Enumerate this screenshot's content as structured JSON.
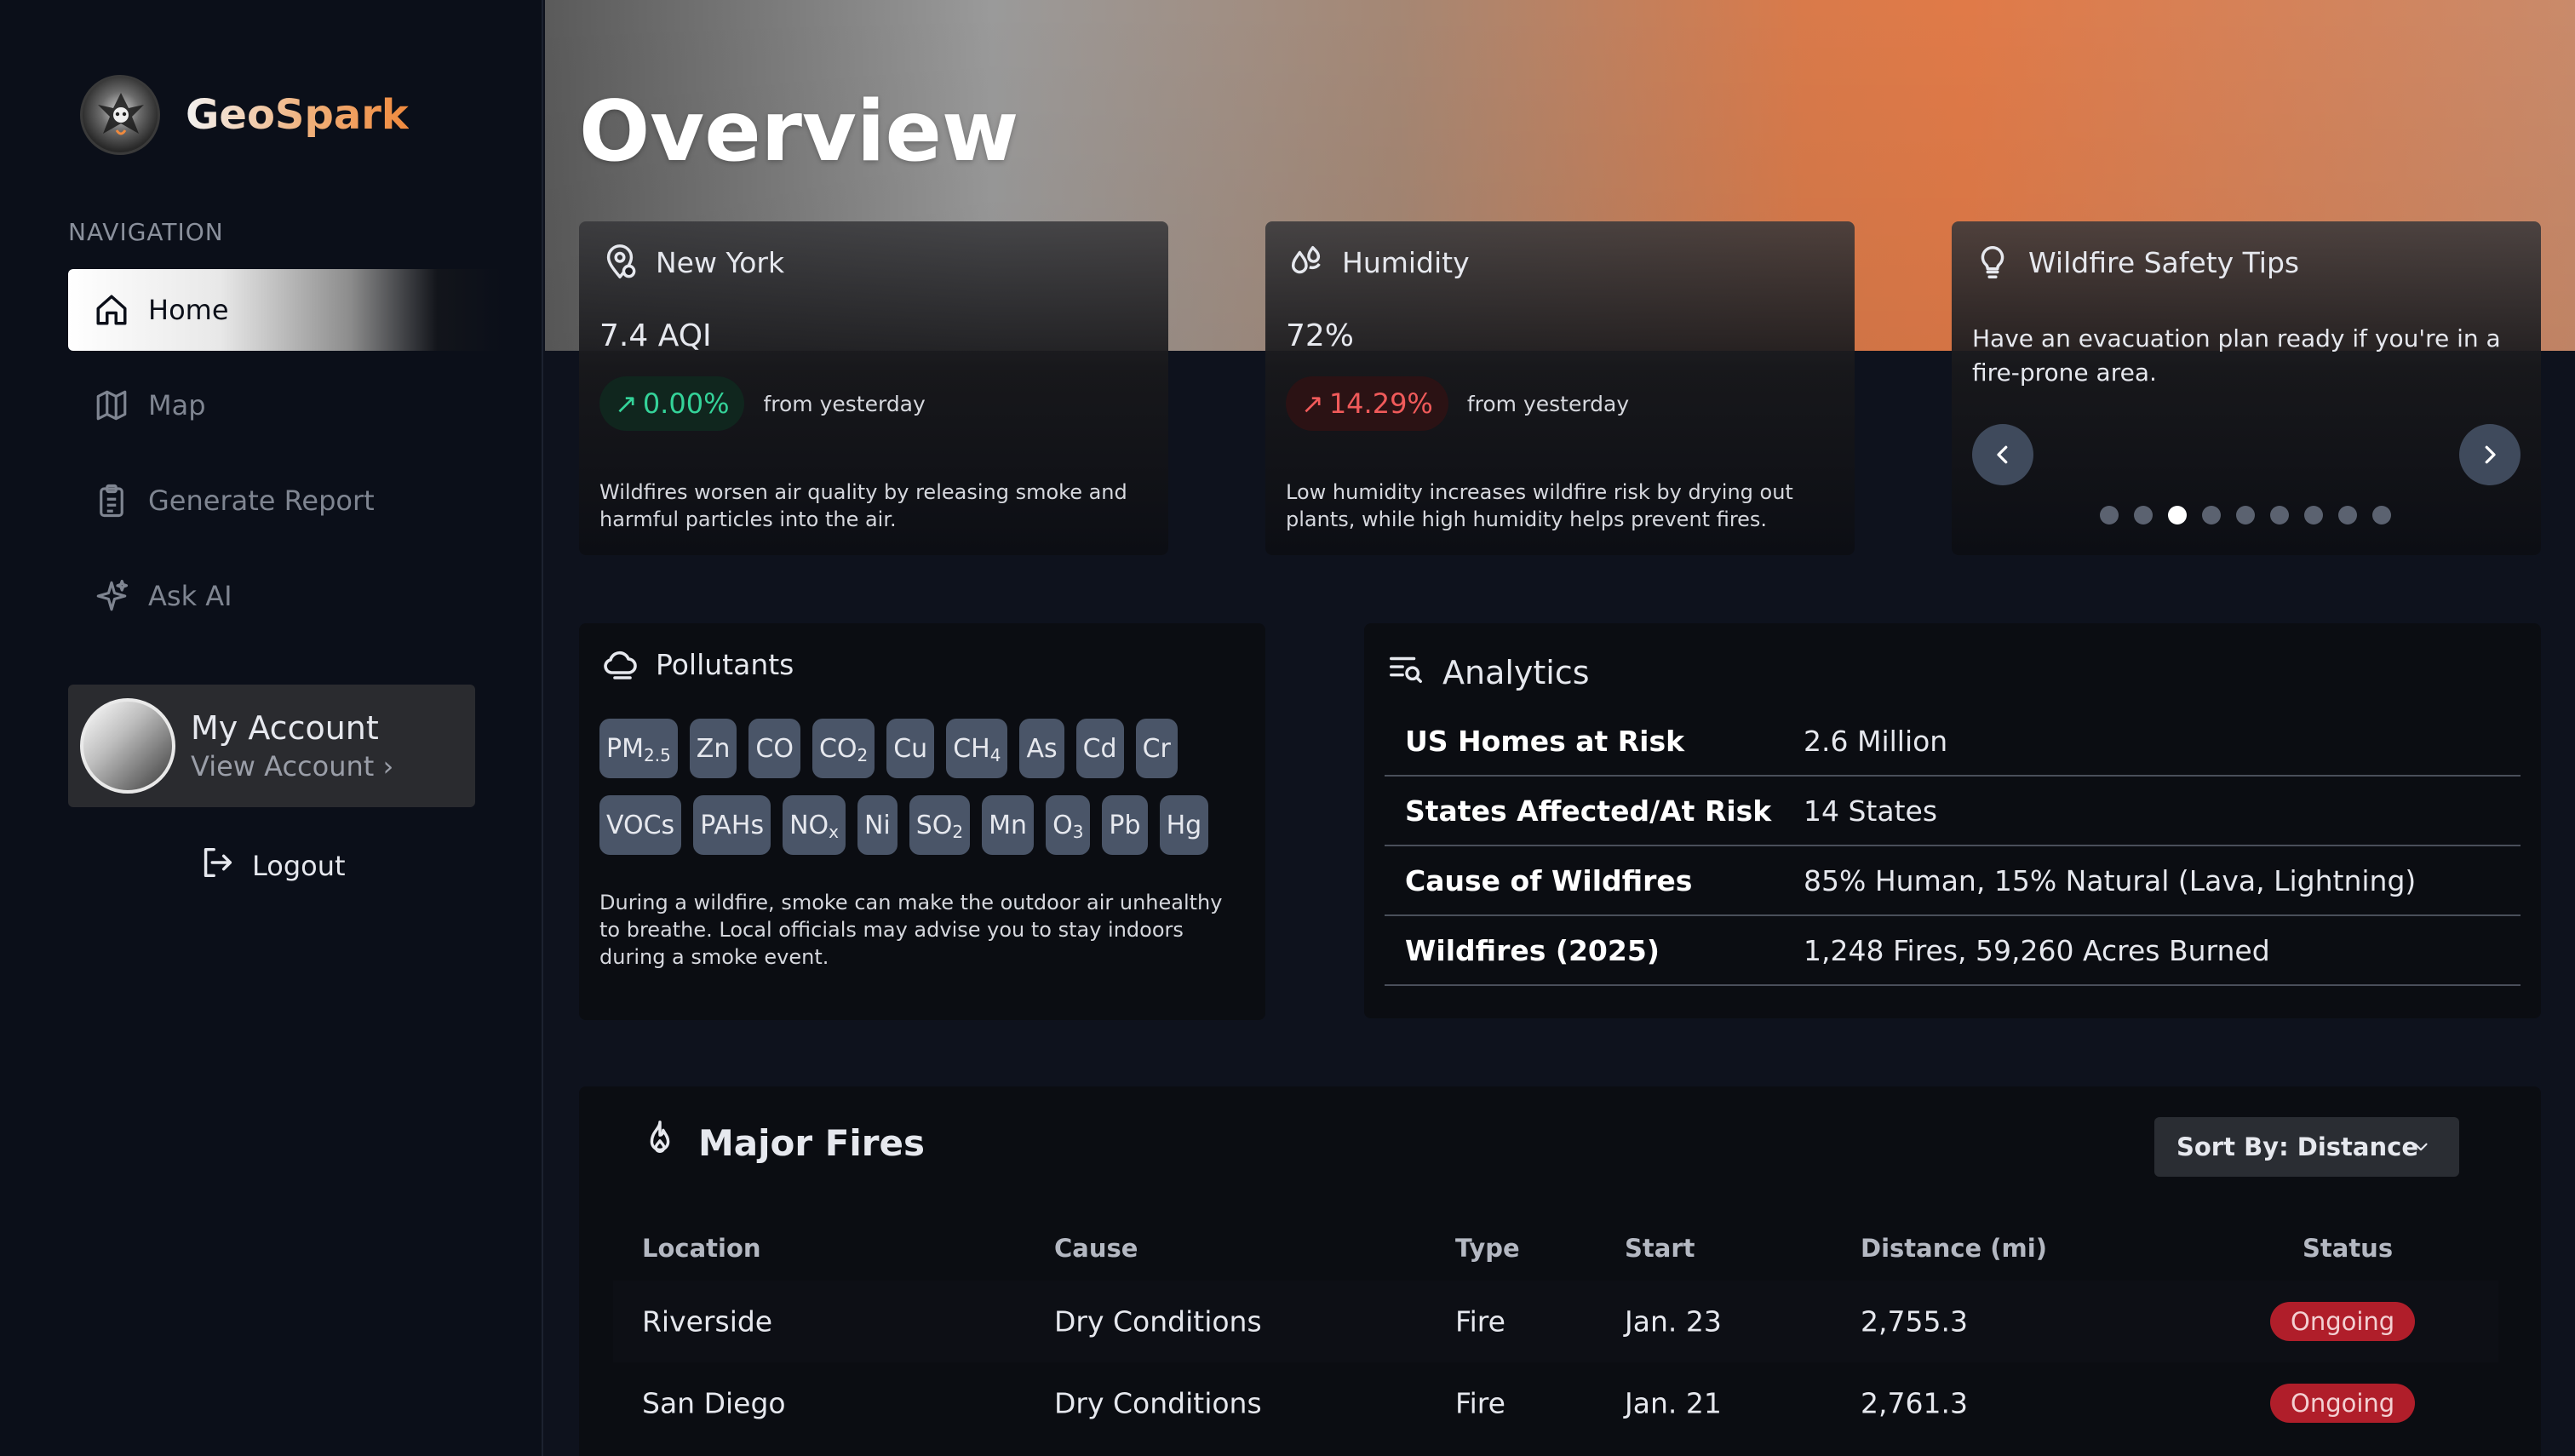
{
  "app": {
    "name": "GeoSpark"
  },
  "sidebar": {
    "heading": "NAVIGATION",
    "items": [
      {
        "label": "Home",
        "icon": "home-icon",
        "active": true
      },
      {
        "label": "Map",
        "icon": "map-icon",
        "active": false
      },
      {
        "label": "Generate Report",
        "icon": "clipboard-icon",
        "active": false
      },
      {
        "label": "Ask AI",
        "icon": "sparkles-icon",
        "active": false
      }
    ],
    "account": {
      "title": "My Account",
      "link": "View Account ›"
    },
    "logout": "Logout"
  },
  "page": {
    "title": "Overview"
  },
  "cards": {
    "aqi": {
      "title": "New York",
      "value": "7.4 AQI",
      "change": "0.00%",
      "change_note": "from yesterday",
      "description": "Wildfires worsen air quality by releasing smoke and harmful particles into the air."
    },
    "humidity": {
      "title": "Humidity",
      "value": "72%",
      "change": "14.29%",
      "change_note": "from yesterday",
      "description": "Low humidity increases wildfire risk by drying out plants, while high humidity helps prevent fires."
    },
    "tips": {
      "title": "Wildfire Safety Tips",
      "text": "Have an evacuation plan ready if you're in a fire-prone area.",
      "slide_count": 9,
      "active_slide": 3
    }
  },
  "pollutants": {
    "title": "Pollutants",
    "row1": [
      {
        "base": "PM",
        "sub": "2.5"
      },
      {
        "base": "Zn",
        "sub": ""
      },
      {
        "base": "CO",
        "sub": ""
      },
      {
        "base": "CO",
        "sub": "2"
      },
      {
        "base": "Cu",
        "sub": ""
      },
      {
        "base": "CH",
        "sub": "4"
      },
      {
        "base": "As",
        "sub": ""
      },
      {
        "base": "Cd",
        "sub": ""
      },
      {
        "base": "Cr",
        "sub": ""
      }
    ],
    "row2": [
      {
        "base": "VOCs",
        "sub": ""
      },
      {
        "base": "PAHs",
        "sub": ""
      },
      {
        "base": "NO",
        "sub": "x"
      },
      {
        "base": "Ni",
        "sub": ""
      },
      {
        "base": "SO",
        "sub": "2"
      },
      {
        "base": "Mn",
        "sub": ""
      },
      {
        "base": "O",
        "sub": "3"
      },
      {
        "base": "Pb",
        "sub": ""
      },
      {
        "base": "Hg",
        "sub": ""
      }
    ],
    "description": "During a wildfire, smoke can make the outdoor air unhealthy to breathe. Local officials may advise you to stay indoors during a smoke event."
  },
  "analytics": {
    "title": "Analytics",
    "rows": [
      {
        "key": "US Homes at Risk",
        "value": "2.6 Million"
      },
      {
        "key": "States Affected/At Risk",
        "value": "14 States"
      },
      {
        "key": "Cause of Wildfires",
        "value": "85% Human, 15% Natural (Lava, Lightning)"
      },
      {
        "key": "Wildfires (2025)",
        "value": "1,248 Fires, 59,260 Acres Burned"
      }
    ]
  },
  "fires": {
    "title": "Major Fires",
    "sort_label": "Sort By: Distance",
    "columns": [
      "Location",
      "Cause",
      "Type",
      "Start",
      "Distance (mi)",
      "Status"
    ],
    "rows": [
      {
        "location": "Riverside",
        "cause": "Dry Conditions",
        "type": "Fire",
        "start": "Jan. 23",
        "distance": "2,755.3",
        "status": "Ongoing"
      },
      {
        "location": "San Diego",
        "cause": "Dry Conditions",
        "type": "Fire",
        "start": "Jan. 21",
        "distance": "2,761.3",
        "status": "Ongoing"
      }
    ]
  },
  "colors": {
    "accent_orange": "#f08a3e",
    "positive": "#34d399",
    "negative": "#f05a5a",
    "status_ongoing": "#b01e2a"
  }
}
